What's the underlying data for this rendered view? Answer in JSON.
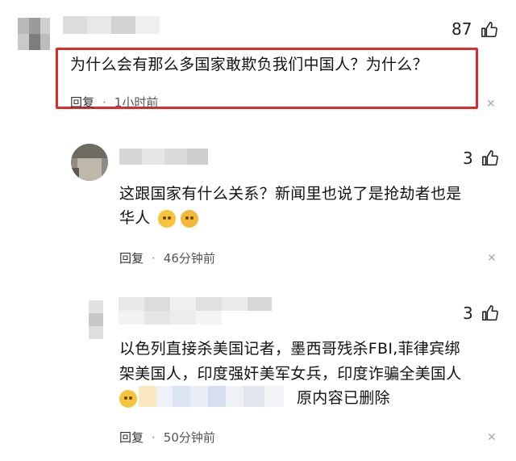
{
  "comments": [
    {
      "likes": "87",
      "text": "为什么会有那么多国家敢欺负我们中国人？为什么？",
      "reply_label": "回复",
      "time": "1小时前"
    },
    {
      "likes": "3",
      "text_line1": "这跟国家有什么关系？新闻里也说了是抢劫者也是",
      "text_line2": "华人",
      "reply_label": "回复",
      "time": "46分钟前"
    },
    {
      "likes": "3",
      "text_line1": "以色列直接杀美国记者，墨西哥残杀FBI,菲律宾绑",
      "text_line2": "架美国人，印度强奸美军女兵，印度诈骗全美国人",
      "deleted_note": "原内容已删除",
      "reply_label": "回复",
      "time": "50分钟前"
    }
  ],
  "icons": {
    "like": "thumbs-up-icon",
    "close": "close-icon",
    "emoji": "emoji-icon"
  },
  "colors": {
    "highlight": "#e02a2a",
    "text": "#111111",
    "meta": "#555555"
  },
  "glyphs": {
    "close": "✕",
    "separator": "·"
  }
}
